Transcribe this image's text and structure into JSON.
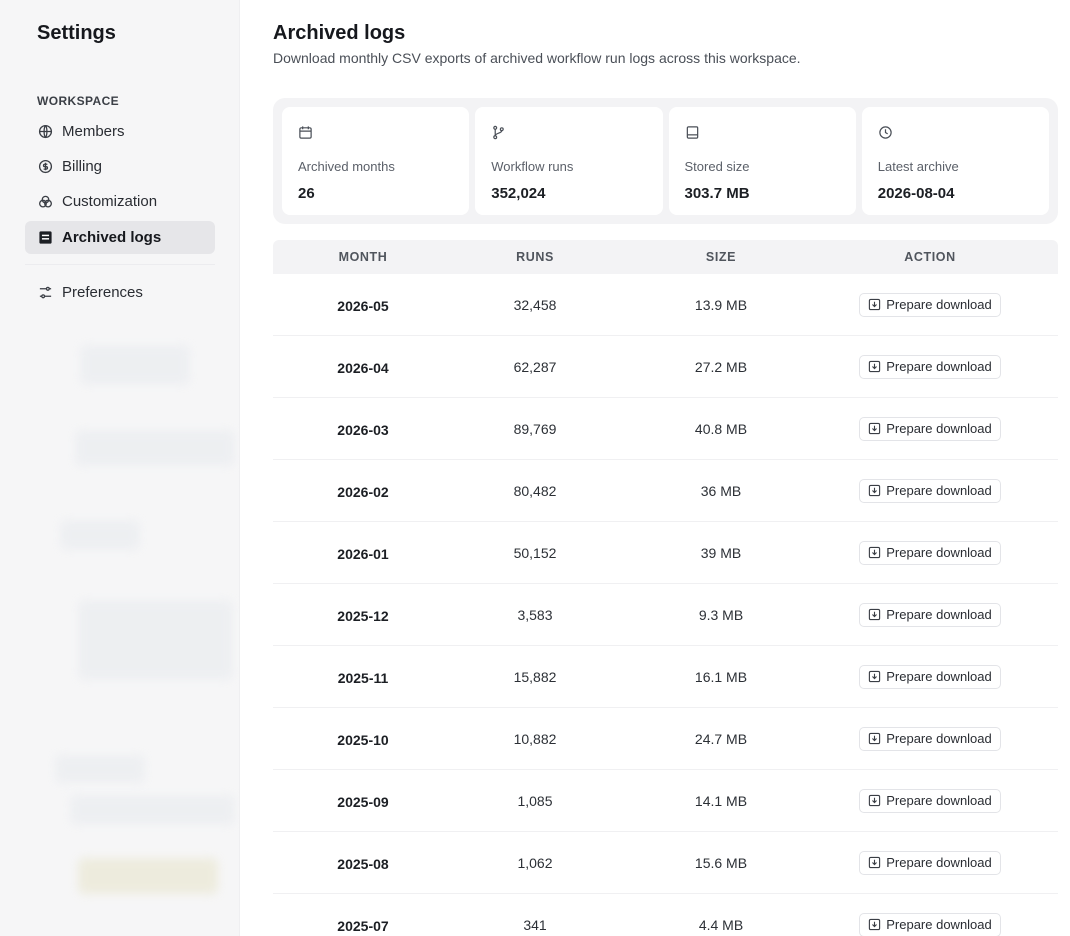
{
  "sidebar": {
    "title": "Settings",
    "section_label": "WORKSPACE",
    "items": [
      {
        "label": "Members",
        "icon": "globe-icon"
      },
      {
        "label": "Billing",
        "icon": "dollar-circle-icon"
      },
      {
        "label": "Customization",
        "icon": "palette-icon"
      },
      {
        "label": "Archived logs",
        "icon": "archive-icon",
        "active": true
      },
      {
        "label": "Preferences",
        "icon": "sliders-icon"
      }
    ]
  },
  "main": {
    "title": "Archived logs",
    "subtitle": "Download monthly CSV exports of archived workflow run logs across this workspace."
  },
  "stats": [
    {
      "label": "Archived months",
      "value": "26",
      "icon": "calendar-icon"
    },
    {
      "label": "Workflow runs",
      "value": "352,024",
      "icon": "branch-icon"
    },
    {
      "label": "Stored size",
      "value": "303.7 MB",
      "icon": "storage-icon"
    },
    {
      "label": "Latest archive",
      "value": "2026-08-04",
      "icon": "clock-icon"
    }
  ],
  "table": {
    "headers": {
      "month": "MONTH",
      "runs": "RUNS",
      "size": "SIZE",
      "action": "ACTION"
    },
    "action_label": "Prepare download",
    "rows": [
      {
        "month": "2026-05",
        "runs": "32,458",
        "size": "13.9 MB"
      },
      {
        "month": "2026-04",
        "runs": "62,287",
        "size": "27.2 MB"
      },
      {
        "month": "2026-03",
        "runs": "89,769",
        "size": "40.8 MB"
      },
      {
        "month": "2026-02",
        "runs": "80,482",
        "size": "36 MB"
      },
      {
        "month": "2026-01",
        "runs": "50,152",
        "size": "39 MB"
      },
      {
        "month": "2025-12",
        "runs": "3,583",
        "size": "9.3 MB"
      },
      {
        "month": "2025-11",
        "runs": "15,882",
        "size": "16.1 MB"
      },
      {
        "month": "2025-10",
        "runs": "10,882",
        "size": "24.7 MB"
      },
      {
        "month": "2025-09",
        "runs": "1,085",
        "size": "14.1 MB"
      },
      {
        "month": "2025-08",
        "runs": "1,062",
        "size": "15.6 MB"
      },
      {
        "month": "2025-07",
        "runs": "341",
        "size": "4.4 MB"
      }
    ]
  }
}
